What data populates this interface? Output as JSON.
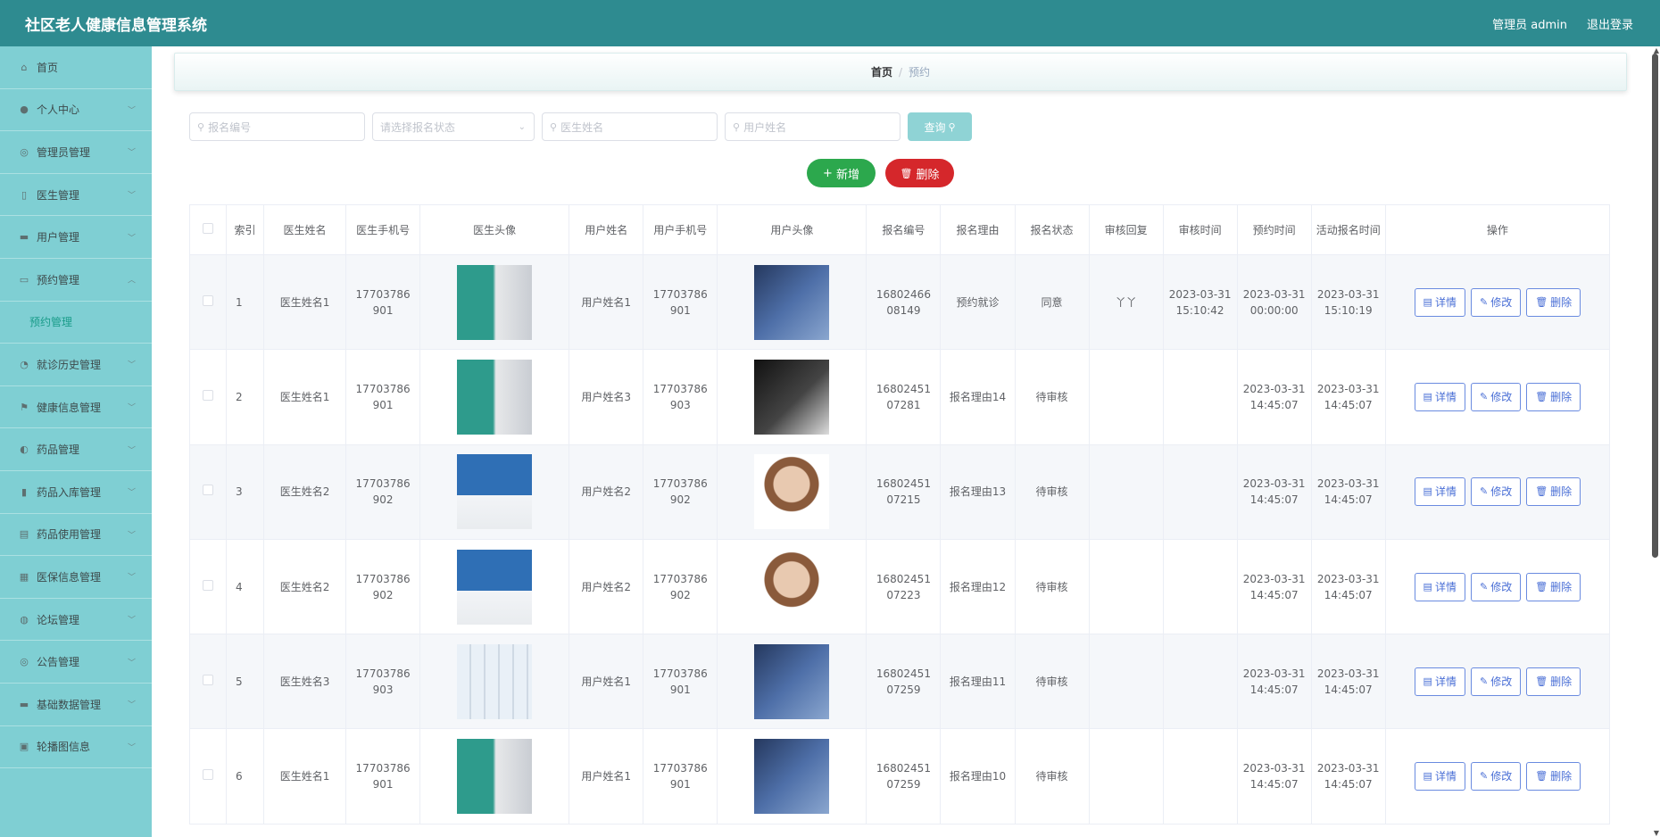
{
  "header": {
    "app_title": "社区老人健康信息管理系统",
    "admin_label": "管理员 admin",
    "logout_label": "退出登录"
  },
  "sidebar": {
    "items": [
      {
        "label": "首页",
        "icon": "home-icon"
      },
      {
        "label": "个人中心",
        "icon": "user-icon"
      },
      {
        "label": "管理员管理",
        "icon": "admin-icon"
      },
      {
        "label": "医生管理",
        "icon": "doctor-icon"
      },
      {
        "label": "用户管理",
        "icon": "people-icon"
      },
      {
        "label": "预约管理",
        "icon": "appointment-icon",
        "expanded": true,
        "sub": "预约管理"
      },
      {
        "label": "就诊历史管理",
        "icon": "history-icon"
      },
      {
        "label": "健康信息管理",
        "icon": "flag-icon"
      },
      {
        "label": "药品管理",
        "icon": "medicine-icon"
      },
      {
        "label": "药品入库管理",
        "icon": "chart-icon"
      },
      {
        "label": "药品使用管理",
        "icon": "box-icon"
      },
      {
        "label": "医保信息管理",
        "icon": "insurance-icon"
      },
      {
        "label": "论坛管理",
        "icon": "forum-icon"
      },
      {
        "label": "公告管理",
        "icon": "notice-icon"
      },
      {
        "label": "基础数据管理",
        "icon": "data-icon"
      },
      {
        "label": "轮播图信息",
        "icon": "image-icon"
      }
    ]
  },
  "breadcrumb": {
    "home": "首页",
    "separator": "/",
    "current": "预约"
  },
  "search": {
    "reg_no_placeholder": "报名编号",
    "status_placeholder": "请选择报名状态",
    "doctor_placeholder": "医生姓名",
    "user_placeholder": "用户姓名",
    "query_label": "查询"
  },
  "actions": {
    "add_label": "新增",
    "delete_label": "删除"
  },
  "table": {
    "headers": [
      "索引",
      "医生姓名",
      "医生手机号",
      "医生头像",
      "用户姓名",
      "用户手机号",
      "用户头像",
      "报名编号",
      "报名理由",
      "报名状态",
      "审核回复",
      "审核时间",
      "预约时间",
      "活动报名时间",
      "操作"
    ],
    "op_labels": {
      "detail": "详情",
      "edit": "修改",
      "delete": "删除"
    },
    "rows": [
      {
        "index": "1",
        "doctor": "医生姓名1",
        "doctor_phone": "17703786901",
        "doctor_avatar": "av-doc-a",
        "user": "用户姓名1",
        "user_phone": "17703786901",
        "user_avatar": "av-user-a",
        "reg_no": "1680246608149",
        "reason": "预约就诊",
        "status": "同意",
        "reply": "丫丫",
        "review_time": "2023-03-31 15:10:42",
        "appt_time": "2023-03-31 00:00:00",
        "reg_time": "2023-03-31 15:10:19"
      },
      {
        "index": "2",
        "doctor": "医生姓名1",
        "doctor_phone": "17703786901",
        "doctor_avatar": "av-doc-a",
        "user": "用户姓名3",
        "user_phone": "17703786903",
        "user_avatar": "av-user-b",
        "reg_no": "1680245107281",
        "reason": "报名理由14",
        "status": "待审核",
        "reply": "",
        "review_time": "",
        "appt_time": "2023-03-31 14:45:07",
        "reg_time": "2023-03-31 14:45:07"
      },
      {
        "index": "3",
        "doctor": "医生姓名2",
        "doctor_phone": "17703786902",
        "doctor_avatar": "av-doc-b",
        "user": "用户姓名2",
        "user_phone": "17703786902",
        "user_avatar": "av-user-c",
        "reg_no": "1680245107215",
        "reason": "报名理由13",
        "status": "待审核",
        "reply": "",
        "review_time": "",
        "appt_time": "2023-03-31 14:45:07",
        "reg_time": "2023-03-31 14:45:07"
      },
      {
        "index": "4",
        "doctor": "医生姓名2",
        "doctor_phone": "17703786902",
        "doctor_avatar": "av-doc-b",
        "user": "用户姓名2",
        "user_phone": "17703786902",
        "user_avatar": "av-user-c",
        "reg_no": "1680245107223",
        "reason": "报名理由12",
        "status": "待审核",
        "reply": "",
        "review_time": "",
        "appt_time": "2023-03-31 14:45:07",
        "reg_time": "2023-03-31 14:45:07"
      },
      {
        "index": "5",
        "doctor": "医生姓名3",
        "doctor_phone": "17703786903",
        "doctor_avatar": "av-doc-c",
        "user": "用户姓名1",
        "user_phone": "17703786901",
        "user_avatar": "av-user-a",
        "reg_no": "1680245107259",
        "reason": "报名理由11",
        "status": "待审核",
        "reply": "",
        "review_time": "",
        "appt_time": "2023-03-31 14:45:07",
        "reg_time": "2023-03-31 14:45:07"
      },
      {
        "index": "6",
        "doctor": "医生姓名1",
        "doctor_phone": "17703786901",
        "doctor_avatar": "av-doc-a",
        "user": "用户姓名1",
        "user_phone": "17703786901",
        "user_avatar": "av-user-a",
        "reg_no": "1680245107259",
        "reason": "报名理由10",
        "status": "待审核",
        "reply": "",
        "review_time": "",
        "appt_time": "2023-03-31 14:45:07",
        "reg_time": "2023-03-31 14:45:07"
      }
    ]
  }
}
